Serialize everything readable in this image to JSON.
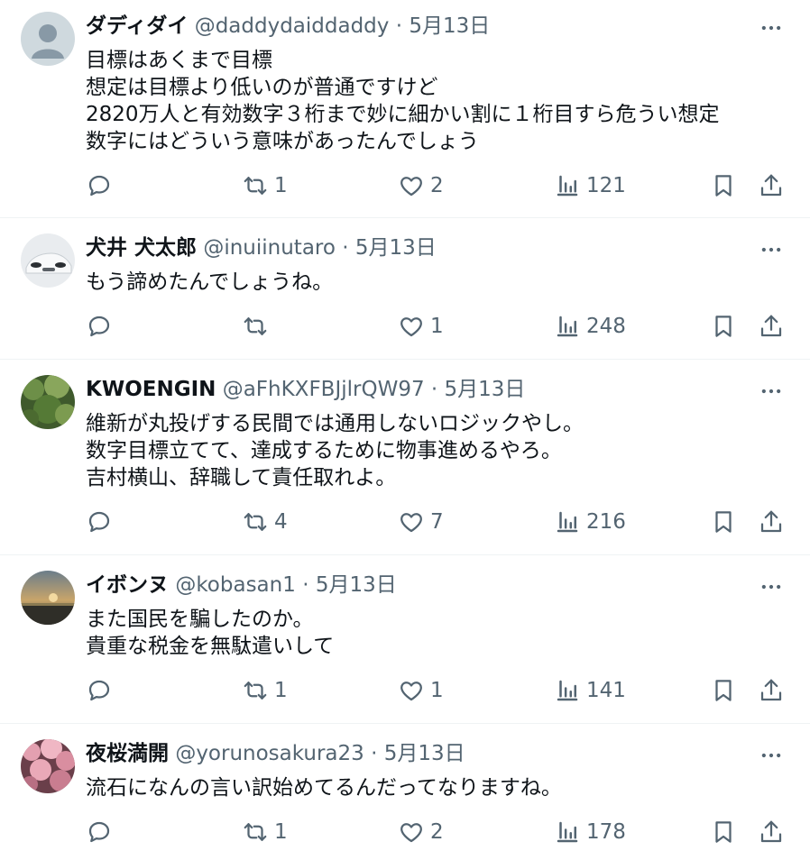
{
  "tweets": [
    {
      "name": "ダディダイ",
      "handle": "@daddydaiddaddy",
      "date": "5月13日",
      "text": "目標はあくまで目標\n想定は目標より低いのが普通ですけど\n2820万人と有効数字３桁まで妙に細かい割に１桁目すら危うい想定\n数字にはどういう意味があったんでしょう",
      "retweets": "1",
      "likes": "2",
      "views": "121",
      "avatar": "default"
    },
    {
      "name": "犬井 犬太郎",
      "handle": "@inuiinutaro",
      "date": "5月13日",
      "text": "もう諦めたんでしょうね。",
      "retweets": "",
      "likes": "1",
      "views": "248",
      "avatar": "car"
    },
    {
      "name": "KWOENGIN",
      "handle": "@aFhKXFBJjlrQW97",
      "date": "5月13日",
      "text": "維新が丸投げする民間では通用しないロジックやし。\n数字目標立てて、達成するために物事進めるやろ。\n吉村横山、辞職して責任取れよ。",
      "retweets": "4",
      "likes": "7",
      "views": "216",
      "avatar": "leaves"
    },
    {
      "name": "イボンヌ",
      "handle": "@kobasan1",
      "date": "5月13日",
      "text": "また国民を騙したのか。\n貴重な税金を無駄遣いして",
      "retweets": "1",
      "likes": "1",
      "views": "141",
      "avatar": "sunset"
    },
    {
      "name": "夜桜満開",
      "handle": "@yorunosakura23",
      "date": "5月13日",
      "text": "流石になんの言い訳始めてるんだってなりますね。",
      "retweets": "1",
      "likes": "2",
      "views": "178",
      "avatar": "sakura"
    }
  ],
  "separator": "·",
  "colors": {
    "text": "#0f1419",
    "secondary": "#536471",
    "border": "#eff3f4"
  },
  "icons": [
    "reply-icon",
    "retweet-icon",
    "like-icon",
    "views-icon",
    "bookmark-icon",
    "share-icon",
    "more-icon"
  ]
}
